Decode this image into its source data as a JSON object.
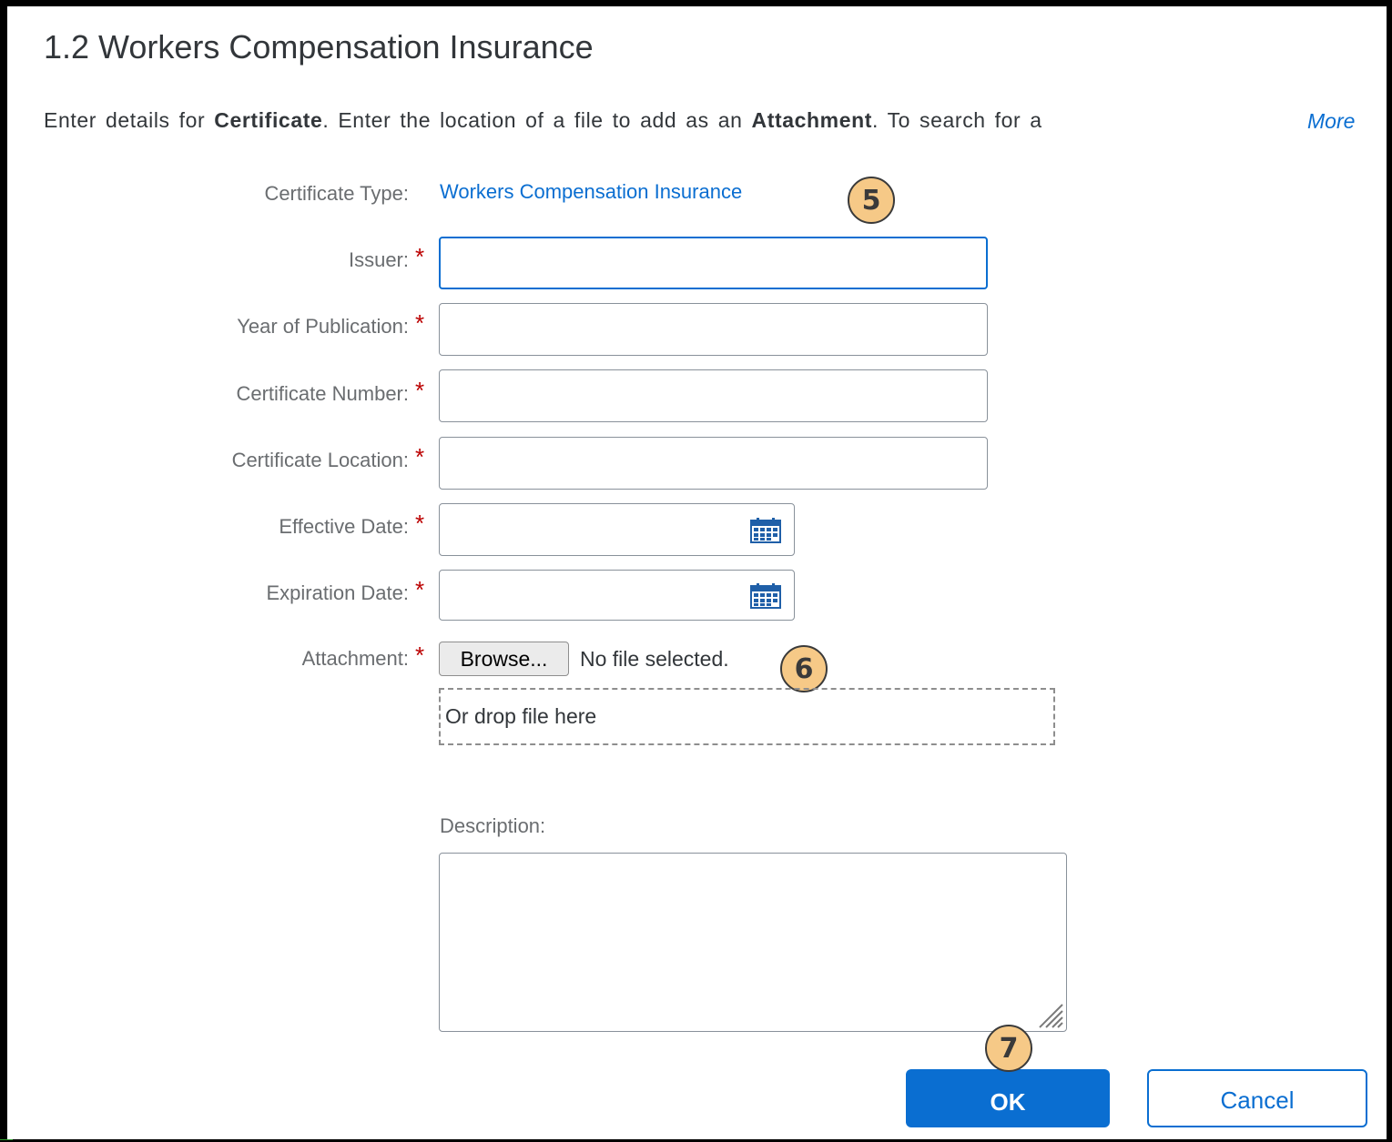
{
  "dialog": {
    "title": "1.2 Workers Compensation Insurance",
    "intro": {
      "p1": "Enter details for ",
      "b1": "Certificate",
      "p2": ". Enter the location of a file to add as an ",
      "b2": "Attachment",
      "p3": ". To search for a"
    },
    "more_link": "More"
  },
  "form": {
    "certificate_type_label": "Certificate Type:",
    "certificate_type_value": "Workers Compensation Insurance",
    "required_marker": "*",
    "fields": {
      "issuer": {
        "label": "Issuer:",
        "value": ""
      },
      "year": {
        "label": "Year of Publication:",
        "value": ""
      },
      "number": {
        "label": "Certificate Number:",
        "value": ""
      },
      "location": {
        "label": "Certificate Location:",
        "value": ""
      },
      "effective_date": {
        "label": "Effective Date:",
        "value": ""
      },
      "expiration_date": {
        "label": "Expiration Date:",
        "value": ""
      }
    },
    "attachment": {
      "label": "Attachment:",
      "browse_label": "Browse...",
      "status": "No file selected.",
      "drop_hint": "Or drop file here"
    },
    "description": {
      "label": "Description:",
      "value": ""
    }
  },
  "callouts": {
    "five": "5",
    "six": "6",
    "seven": "7"
  },
  "buttons": {
    "ok": "OK",
    "cancel": "Cancel"
  },
  "icons": {
    "calendar": "calendar-icon",
    "resize": "resize-grip-icon"
  },
  "colors": {
    "accent": "#0a6ed1",
    "required": "#bb0000",
    "callout": "#f6c987"
  }
}
